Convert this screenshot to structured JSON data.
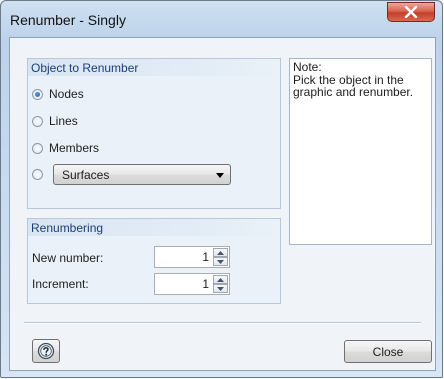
{
  "window": {
    "title": "Renumber - Singly",
    "close_icon": "close-icon"
  },
  "object_group": {
    "title": "Object to Renumber",
    "options": [
      {
        "label": "Nodes",
        "checked": true
      },
      {
        "label": "Lines",
        "checked": false
      },
      {
        "label": "Members",
        "checked": false
      }
    ],
    "surfaces_option": {
      "checked": false,
      "dropdown_value": "Surfaces"
    }
  },
  "renumbering_group": {
    "title": "Renumbering",
    "new_number": {
      "label": "New number:",
      "value": "1"
    },
    "increment": {
      "label": "Increment:",
      "value": "1"
    }
  },
  "note": {
    "title": "Note:",
    "text": "Pick the object in the graphic and renumber."
  },
  "footer": {
    "help_icon": "help-icon",
    "close_label": "Close"
  }
}
